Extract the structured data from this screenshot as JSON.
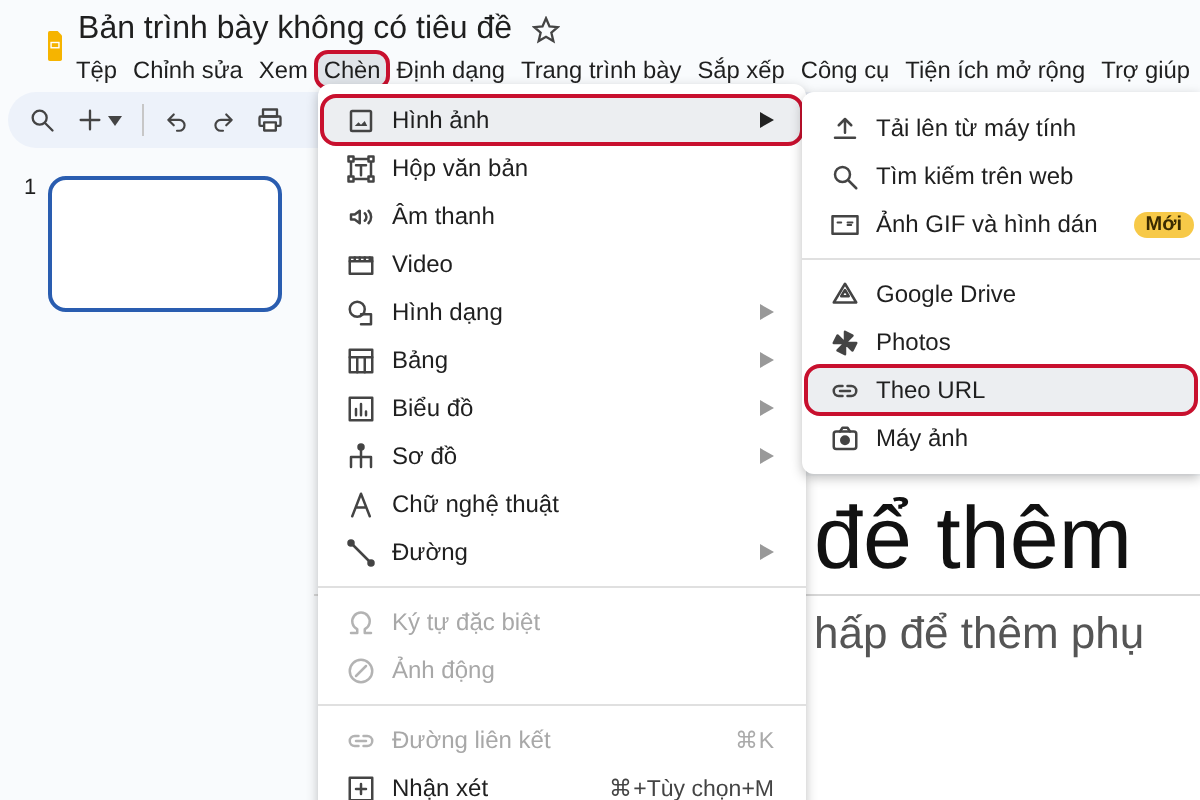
{
  "window": {
    "title": "Bản trình bày không có tiêu đề",
    "starred": false
  },
  "menubar": [
    {
      "label": "Tệp",
      "selected": false,
      "highlighted": false
    },
    {
      "label": "Chỉnh sửa",
      "selected": false,
      "highlighted": false
    },
    {
      "label": "Xem",
      "selected": false,
      "highlighted": false
    },
    {
      "label": "Chèn",
      "selected": true,
      "highlighted": true
    },
    {
      "label": "Định dạng",
      "selected": false,
      "highlighted": false
    },
    {
      "label": "Trang trình bày",
      "selected": false,
      "highlighted": false
    },
    {
      "label": "Sắp xếp",
      "selected": false,
      "highlighted": false
    },
    {
      "label": "Công cụ",
      "selected": false,
      "highlighted": false
    },
    {
      "label": "Tiện ích mở rộng",
      "selected": false,
      "highlighted": false
    },
    {
      "label": "Trợ giúp",
      "selected": false,
      "highlighted": false
    }
  ],
  "filmstrip": [
    {
      "number": "1",
      "selected": true
    }
  ],
  "slide": {
    "title": "để thêm",
    "subtitle": "hấp để thêm phụ"
  },
  "insert_menu": [
    {
      "kind": "item",
      "label": "Hình ảnh",
      "submenu": true,
      "disabled": false,
      "highlighted": true
    },
    {
      "kind": "item",
      "label": "Hộp văn bản",
      "submenu": false,
      "disabled": false,
      "highlighted": false
    },
    {
      "kind": "item",
      "label": "Âm thanh",
      "submenu": false,
      "disabled": false,
      "highlighted": false
    },
    {
      "kind": "item",
      "label": "Video",
      "submenu": false,
      "disabled": false,
      "highlighted": false
    },
    {
      "kind": "item",
      "label": "Hình dạng",
      "submenu": true,
      "disabled": false,
      "highlighted": false
    },
    {
      "kind": "item",
      "label": "Bảng",
      "submenu": true,
      "disabled": false,
      "highlighted": false
    },
    {
      "kind": "item",
      "label": "Biểu đồ",
      "submenu": true,
      "disabled": false,
      "highlighted": false
    },
    {
      "kind": "item",
      "label": "Sơ đồ",
      "submenu": true,
      "disabled": false,
      "highlighted": false
    },
    {
      "kind": "item",
      "label": "Chữ nghệ thuật",
      "submenu": false,
      "disabled": false,
      "highlighted": false
    },
    {
      "kind": "item",
      "label": "Đường",
      "submenu": true,
      "disabled": false,
      "highlighted": false
    },
    {
      "kind": "separator"
    },
    {
      "kind": "item",
      "label": "Ký tự đặc biệt",
      "submenu": false,
      "disabled": true,
      "highlighted": false
    },
    {
      "kind": "item",
      "label": "Ảnh động",
      "submenu": false,
      "disabled": true,
      "highlighted": false
    },
    {
      "kind": "separator"
    },
    {
      "kind": "item",
      "label": "Đường liên kết",
      "submenu": false,
      "disabled": true,
      "highlighted": false,
      "shortcut": "⌘K"
    },
    {
      "kind": "item",
      "label": "Nhận xét",
      "submenu": false,
      "disabled": false,
      "highlighted": false,
      "shortcut": "⌘+Tùy chọn+M"
    }
  ],
  "image_submenu": [
    {
      "kind": "item",
      "label": "Tải lên từ máy tính",
      "disabled": false,
      "highlighted": false
    },
    {
      "kind": "item",
      "label": "Tìm kiếm trên web",
      "disabled": false,
      "highlighted": false
    },
    {
      "kind": "item",
      "label": "Ảnh GIF và hình dán",
      "disabled": false,
      "highlighted": false,
      "badge": "Mới"
    },
    {
      "kind": "separator"
    },
    {
      "kind": "item",
      "label": "Google Drive",
      "disabled": false,
      "highlighted": false
    },
    {
      "kind": "item",
      "label": "Photos",
      "disabled": false,
      "highlighted": false
    },
    {
      "kind": "item",
      "label": "Theo URL",
      "disabled": false,
      "highlighted": true
    },
    {
      "kind": "item",
      "label": "Máy ảnh",
      "disabled": false,
      "highlighted": false
    }
  ]
}
